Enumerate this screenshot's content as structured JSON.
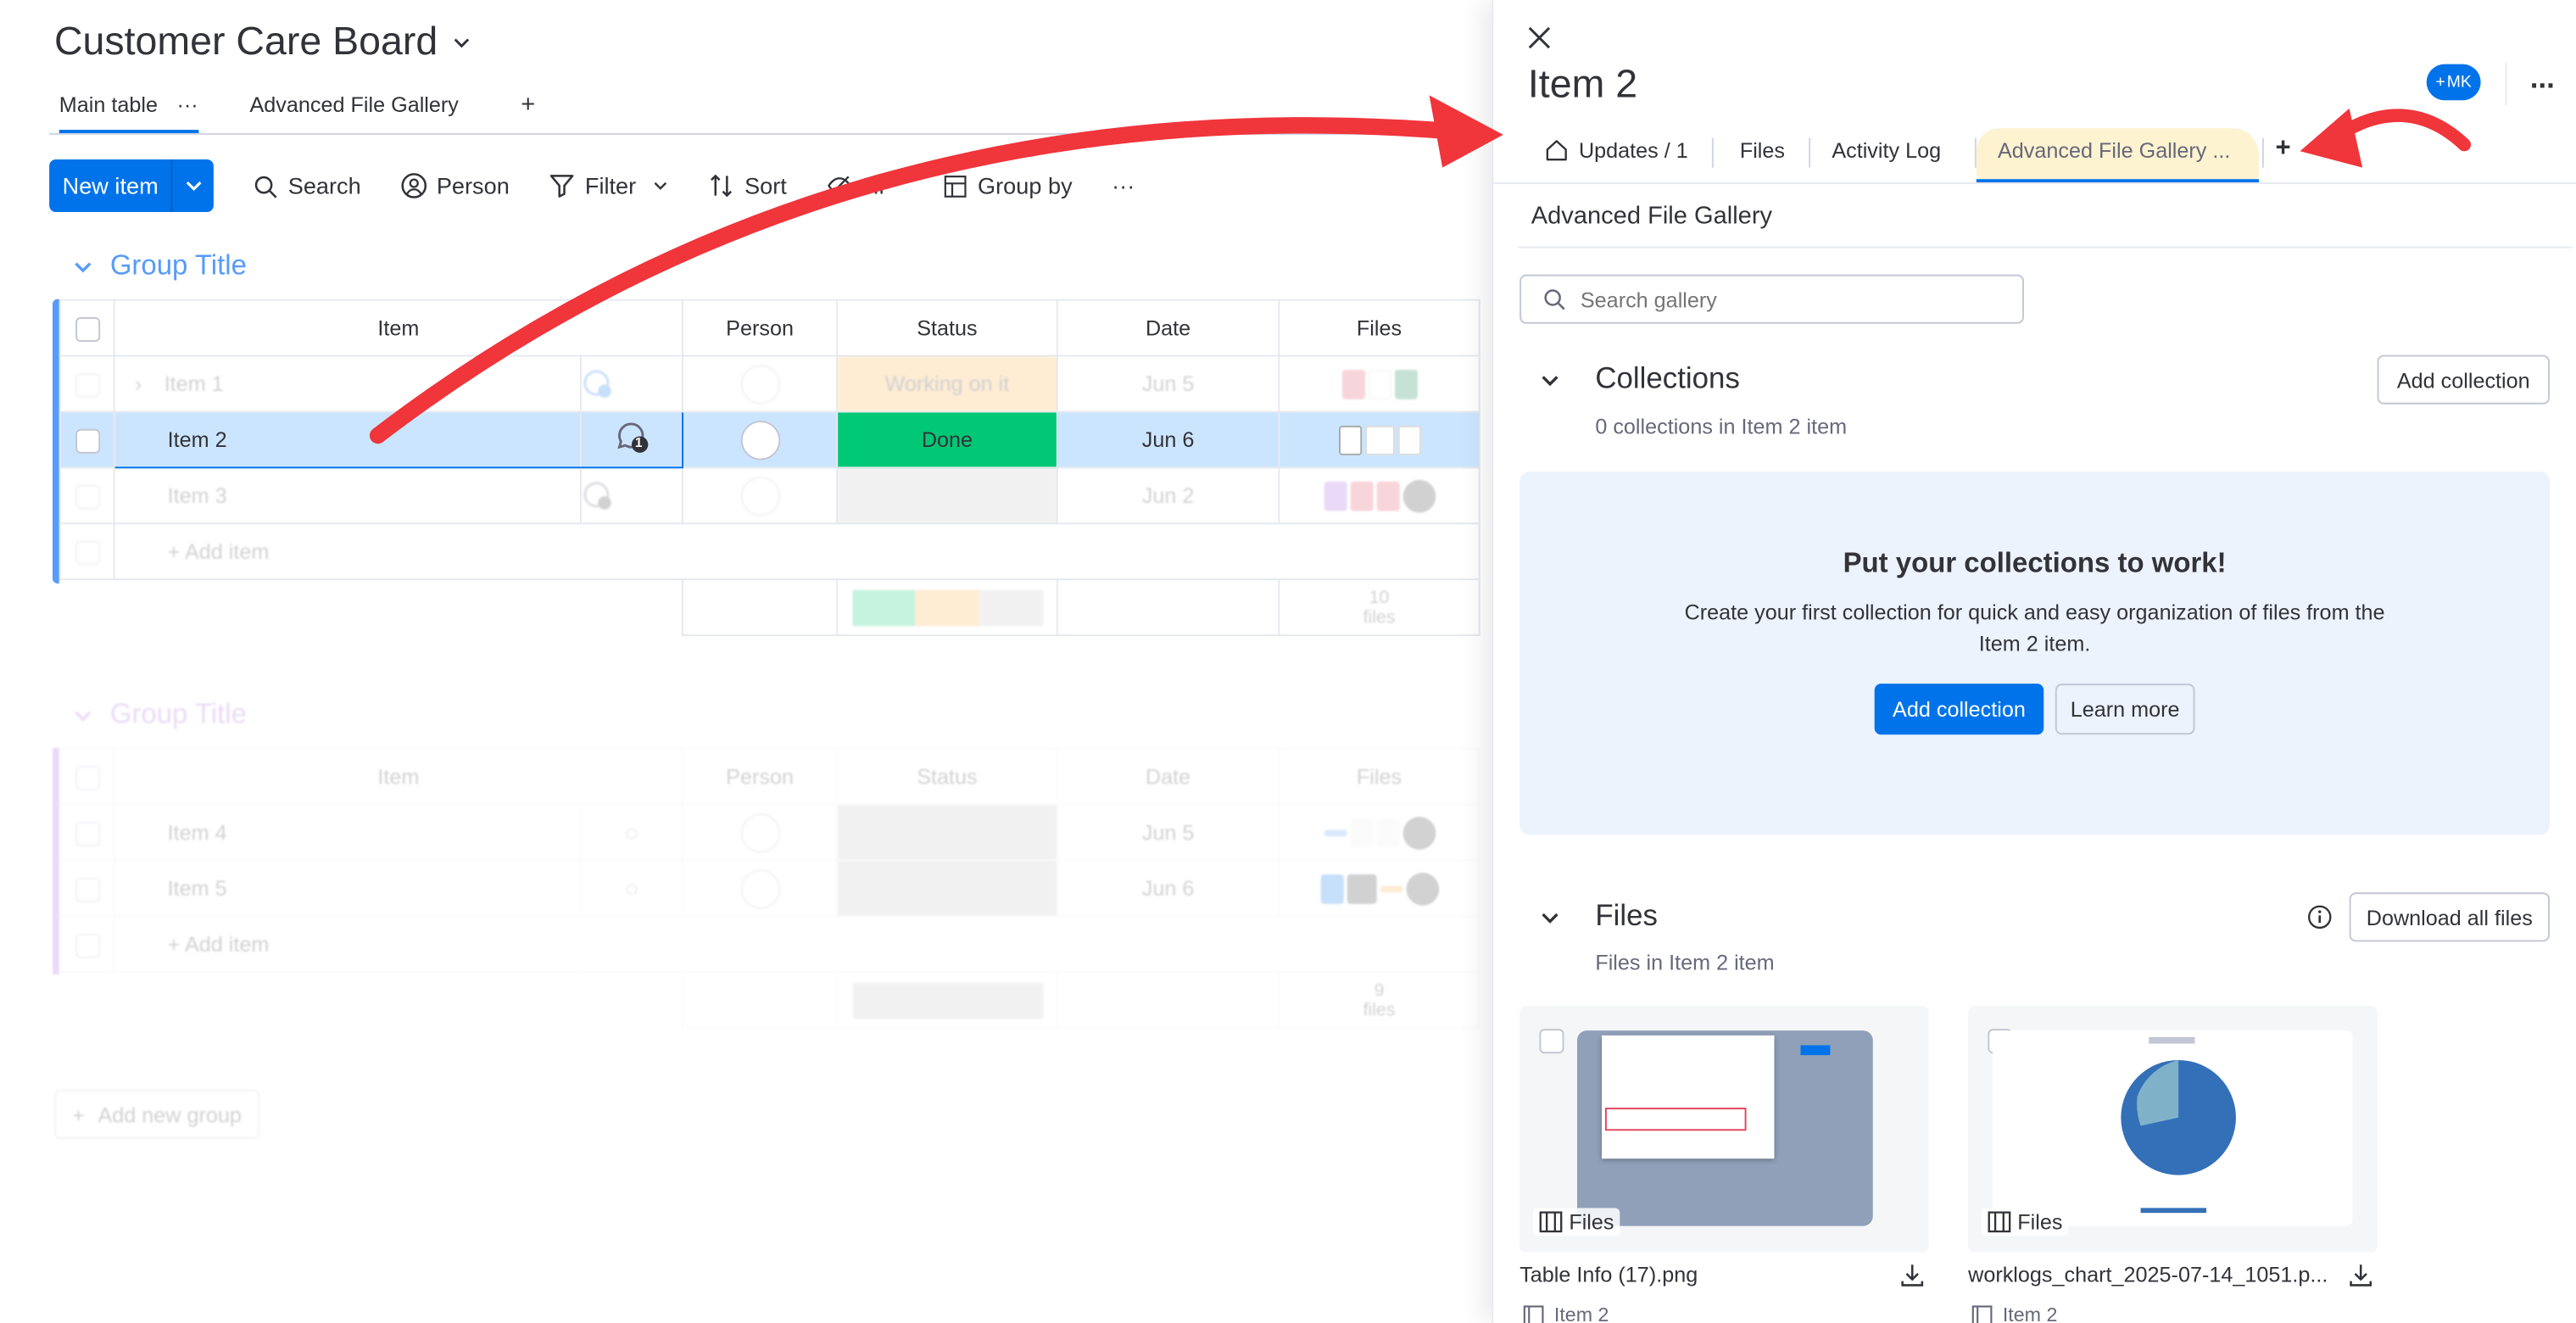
{
  "board": {
    "title": "Customer Care Board",
    "views": [
      {
        "label": "Main table"
      },
      {
        "label": "Advanced File Gallery"
      }
    ],
    "add_view": "+",
    "more": "···",
    "toolbar": {
      "new_item": "New item",
      "search": "Search",
      "person": "Person",
      "filter": "Filter",
      "sort": "Sort",
      "hide": "Hi",
      "group_by": "Group by",
      "more": "···"
    },
    "columns": {
      "item": "Item",
      "person": "Person",
      "status": "Status",
      "date": "Date",
      "files": "Files"
    },
    "groups": [
      {
        "title": "Group Title",
        "color": "#579bfc",
        "rows": [
          {
            "name": "Item 1",
            "status": "Working on it",
            "status_color": "#fdab3d",
            "date": "Jun 5"
          },
          {
            "name": "Item 2",
            "status": "Done",
            "status_color": "#00c875",
            "date": "Jun 6",
            "update_count": "1"
          },
          {
            "name": "Item 3",
            "status": "",
            "status_color": "#c4c4c4",
            "date": "Jun 2"
          }
        ],
        "add_item": "+ Add item",
        "files_summary": {
          "count": "10",
          "label": "files"
        }
      },
      {
        "title": "Group Title",
        "color": "#a25ddc",
        "rows": [
          {
            "name": "Item 4",
            "status": "",
            "status_color": "#c4c4c4",
            "date": "Jun 5"
          },
          {
            "name": "Item 5",
            "status": "",
            "status_color": "#c4c4c4",
            "date": "Jun 6"
          }
        ],
        "add_item": "+ Add item",
        "files_summary": {
          "count": "9",
          "label": "files"
        }
      }
    ],
    "add_group": "Add new group"
  },
  "panel": {
    "title": "Item 2",
    "avatar_initials": "MK",
    "tabs": [
      {
        "label": "Updates / 1"
      },
      {
        "label": "Files"
      },
      {
        "label": "Activity Log"
      },
      {
        "label": "Advanced File Gallery ..."
      }
    ],
    "add_tab": "+",
    "section_title": "Advanced File Gallery",
    "search_placeholder": "Search gallery",
    "collections": {
      "title": "Collections",
      "subtitle": "0 collections in Item 2 item",
      "add_button": "Add collection",
      "empty_title": "Put your collections to work!",
      "empty_text": "Create your first collection for quick and easy organization of files from the Item 2 item.",
      "add_cta": "Add collection",
      "learn_more": "Learn more"
    },
    "files": {
      "title": "Files",
      "subtitle": "Files in Item 2 item",
      "download_all": "Download all files",
      "cards": [
        {
          "name": "Table Info (17).png",
          "chip": "Files",
          "item": "Item 2"
        },
        {
          "name": "worklogs_chart_2025-07-14_1051.p...",
          "chip": "Files",
          "item": "Item 2"
        }
      ]
    }
  },
  "colors": {
    "accent": "#0073ea",
    "arrow": "#f0353b",
    "done": "#00c875",
    "working": "#fdab3d"
  }
}
